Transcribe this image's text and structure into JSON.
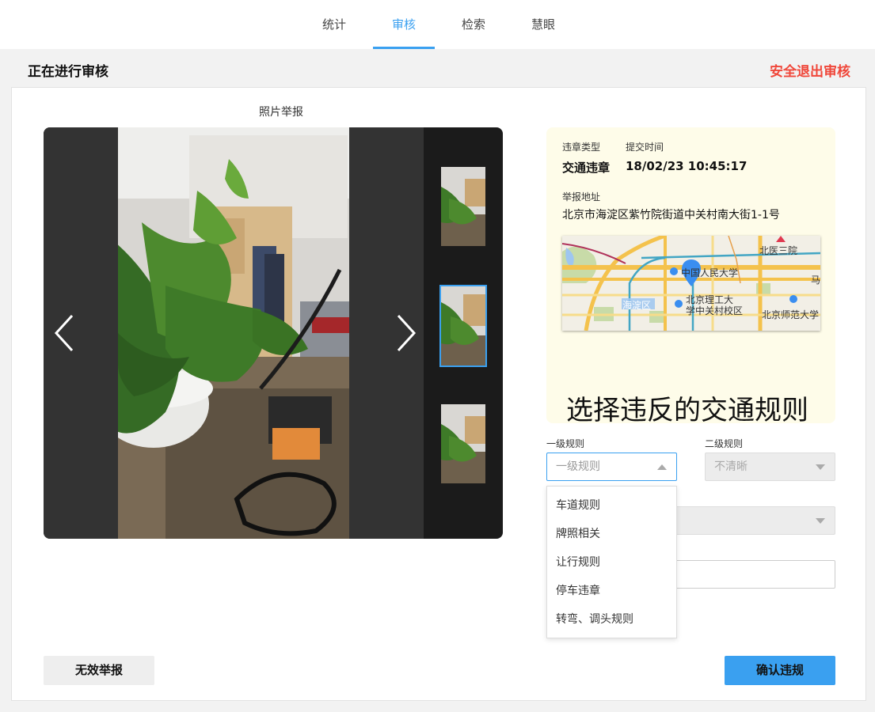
{
  "nav": {
    "tabs": [
      {
        "label": "统计"
      },
      {
        "label": "审核"
      },
      {
        "label": "检索"
      },
      {
        "label": "慧眼"
      }
    ],
    "active_tab": "审核"
  },
  "header": {
    "title": "正在进行审核",
    "exit_label": "安全退出审核"
  },
  "photo_section": {
    "label": "照片举报",
    "thumbnails_count": 3,
    "active_thumbnail": 2
  },
  "report": {
    "type_label": "违章类型",
    "type_value": "交通违章",
    "time_label": "提交时间",
    "time_value": "18/02/23 10:45:17",
    "address_label": "举报地址",
    "address_value": "北京市海淀区紫竹院街道中关村南大街1-1号"
  },
  "map": {
    "labels": {
      "north_third_hospital": "北医三院",
      "renmin_univ": "中国人民大学",
      "haidian": "海淀区",
      "bit": "北京理工大",
      "bit2": "学中关村校区",
      "bnu": "北京师范大学",
      "edge_char": "马"
    },
    "pin_color": "#3a8ef0"
  },
  "rules": {
    "heading": "选择违反的交通规则",
    "level1_label": "一级规则",
    "level1_placeholder": "一级规则",
    "level2_label": "二级规则",
    "level2_placeholder": "不清晰",
    "level1_options": [
      "车道规则",
      "牌照相关",
      "让行规则",
      "停车违章",
      "转弯、调头规则"
    ]
  },
  "actions": {
    "invalid_label": "无效举报",
    "confirm_label": "确认违规"
  },
  "colors": {
    "accent": "#3aa0f0",
    "danger": "#f0473a",
    "info_bg": "#fefce9"
  }
}
